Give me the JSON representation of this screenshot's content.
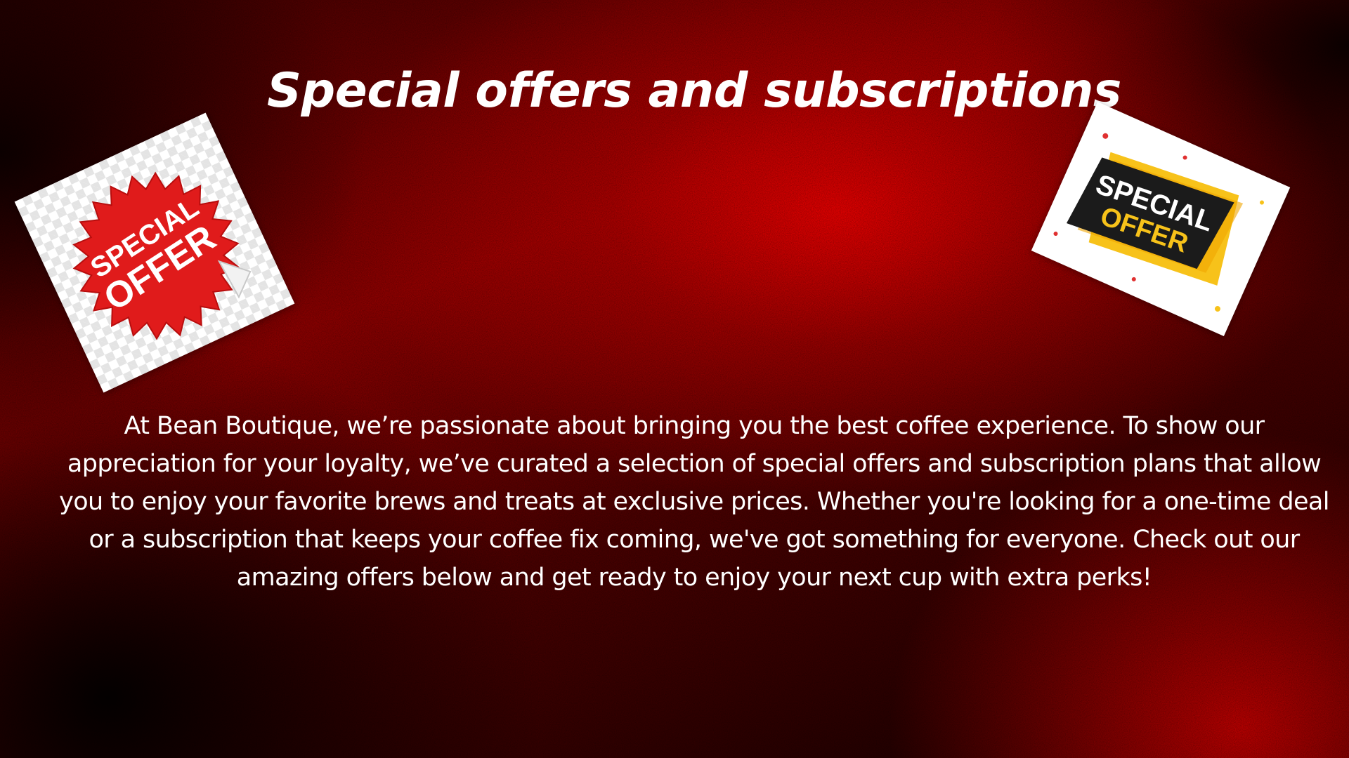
{
  "title": "Special offers and subscriptions",
  "body": "At Bean Boutique, we’re passionate about bringing you the best coffee experience. To show our appreciation for your loyalty, we’ve curated a selection of special offers and subscription plans that allow you to enjoy your favorite brews and treats at exclusive prices. Whether you're looking for a one-time deal or a subscription that keeps your coffee fix coming, we've got something for everyone. Check out our amazing offers below and get ready to enjoy your next cup with extra perks!",
  "stickers": {
    "left": {
      "icon": "special-offer-starburst-icon",
      "line1": "SPECIAL",
      "line2": "OFFER"
    },
    "right": {
      "icon": "special-offer-banner-icon",
      "line1": "SPECIAL",
      "line2": "OFFER"
    }
  },
  "colors": {
    "background_red": "#d40000",
    "background_dark": "#140000",
    "text": "#ffffff",
    "starburst_red": "#e01b1b",
    "banner_yellow": "#f7c21a",
    "banner_dark": "#1b1b1b"
  }
}
